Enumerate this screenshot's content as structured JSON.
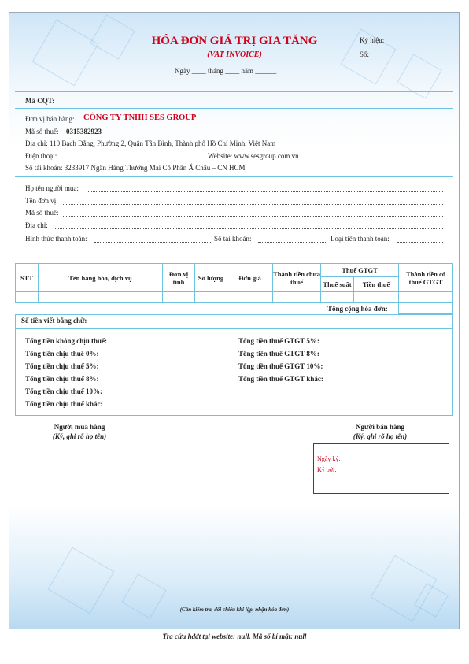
{
  "header": {
    "title": "HÓA ĐƠN GIÁ TRỊ GIA TĂNG",
    "subtitle": "(VAT INVOICE)",
    "date_line": "Ngày ____ tháng ____ năm ______",
    "symbol_label": "Ký hiệu:",
    "number_label": "Số:"
  },
  "cqt_label": "Mã CQT:",
  "seller": {
    "unit_label": "Đơn vị bán hàng:",
    "unit_name": "CÔNG TY TNHH SES GROUP",
    "tax_label": "Mã số thuế:",
    "tax_code": "0315382923",
    "address": "Địa chỉ:  110 Bạch Đằng, Phường 2, Quận Tân Bình, Thành phố Hồ Chí Minh, Việt Nam",
    "phone_label": "Điện thoại:",
    "website": "Website: www.sesgroup.com.vn",
    "account": "Số tài khoản: 3233917 Ngân Hàng Thương Mại Cổ Phần Á Châu – CN HCM"
  },
  "buyer": {
    "name_label": "Họ tên người mua:",
    "unit_label": "Tên đơn vị:",
    "tax_label": "Mã số thuế:",
    "address_label": "Địa chỉ:",
    "payment_label": "Hình thức thanh toán:",
    "account_label": "Số tài khoản:",
    "currency_label": "Loại tiền thanh toán:"
  },
  "table": {
    "headers": {
      "stt": "STT",
      "name": "Tên hàng hóa, dịch vụ",
      "unit": "Đơn vị tính",
      "qty": "Số lượng",
      "price": "Đơn giá",
      "pretax": "Thành tiền chưa thuế",
      "vat_group": "Thuế GTGT",
      "vat_rate": "Thuế suất",
      "vat_amount": "Tiền thuế",
      "total": "Thành tiền có thuế GTGT"
    },
    "total_label": "Tổng cộng hóa đơn:"
  },
  "words_label": "Số tiền viết bằng chữ:",
  "summary": {
    "left": [
      "Tổng tiền không chịu thuế:",
      "Tổng tiền chịu thuế 0%:",
      "Tổng tiền chịu thuế 5%:",
      "Tổng tiền chịu thuế 8%:",
      "Tổng tiền chịu thuế 10%:",
      "Tổng tiền chịu thuế khác:"
    ],
    "right": [
      "Tổng tiền thuế GTGT 5%:",
      "Tổng tiền thuế GTGT 8%:",
      "Tổng tiền thuế GTGT 10%:",
      "Tổng tiền thuế GTGT khác:"
    ]
  },
  "signatures": {
    "buyer_title": "Người mua hàng",
    "buyer_note": "(Ký, ghi rõ họ tên)",
    "seller_title": "Người bán hàng",
    "seller_note": "(Ký, ghi rõ họ tên)",
    "sign_date": "Ngày ký:",
    "signer": "Ký bởi:"
  },
  "footer_note": "(Cần kiểm tra, đối chiếu khi lập, nhận hóa đơn)",
  "lookup": "Tra cứu hđđt tại website: null. Mã số bí mật: null"
}
